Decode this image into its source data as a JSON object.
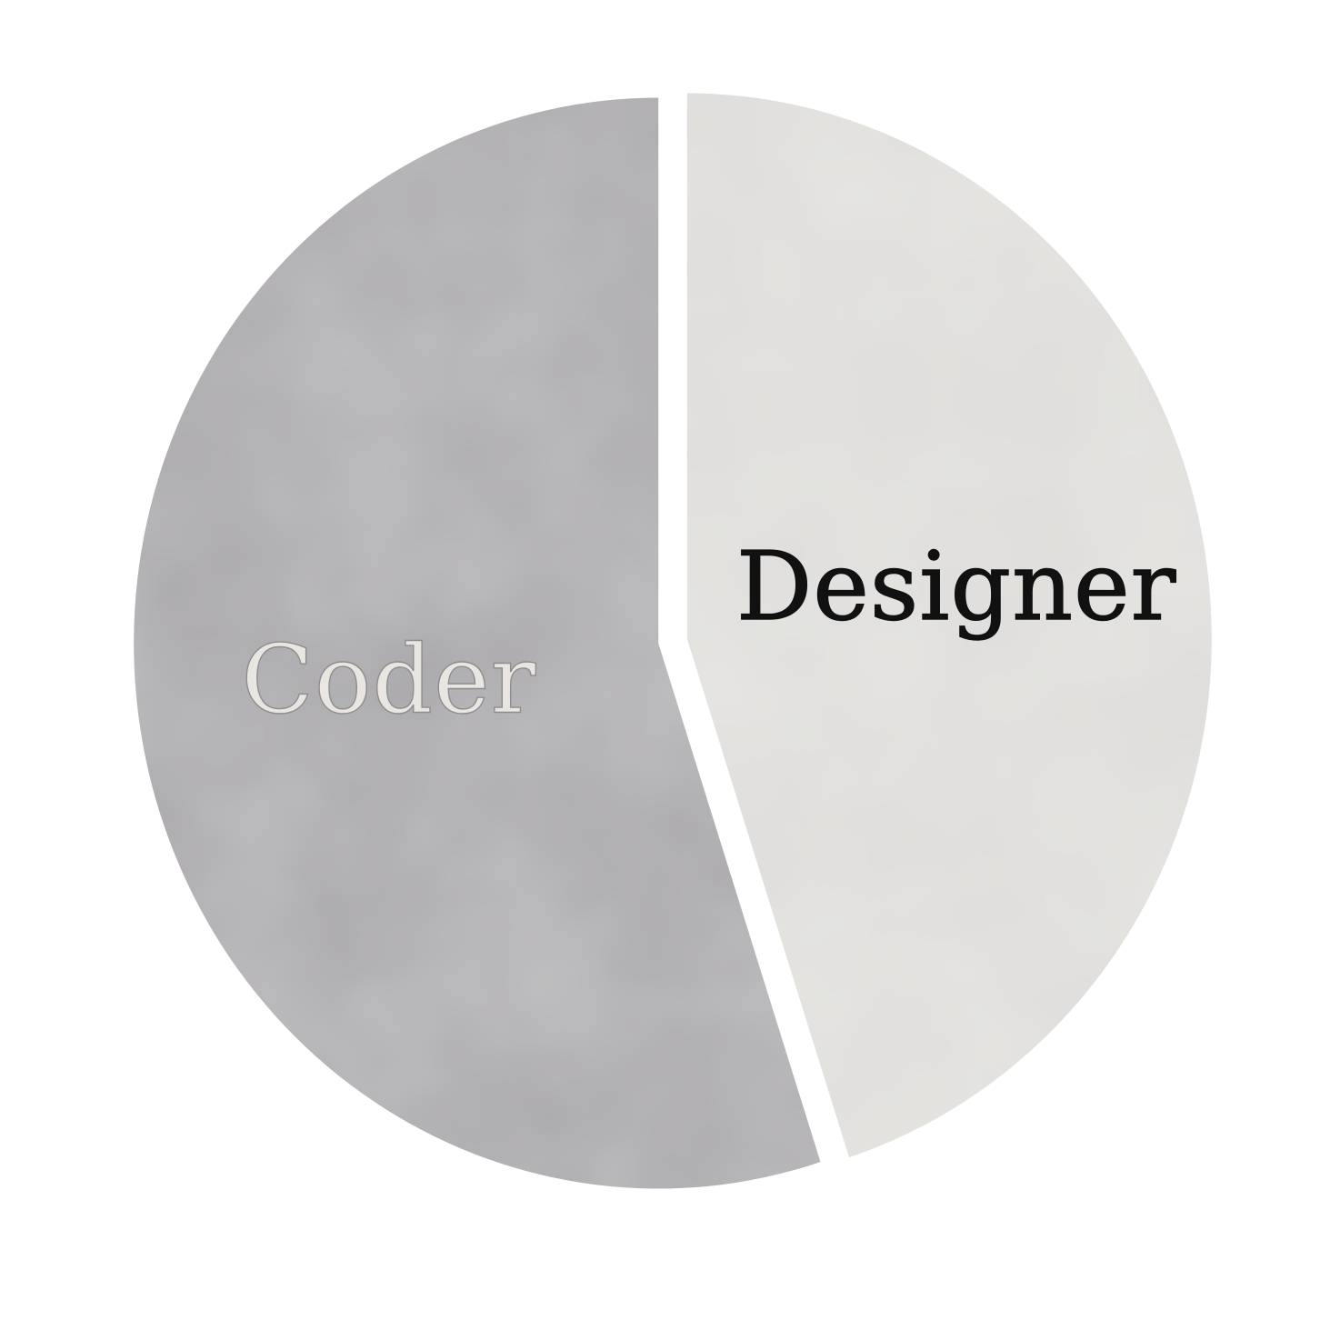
{
  "chart_data": {
    "type": "pie",
    "title": "",
    "categories": [
      "Coder",
      "Designer"
    ],
    "values": [
      55,
      45
    ],
    "colors": [
      "#a9a7aa",
      "#deddda"
    ],
    "label_colors": [
      "#e9e6e1",
      "#111111"
    ],
    "label_outline_colors": [
      "#8e8c8f",
      "#111111"
    ],
    "legend": "none",
    "grid": false
  }
}
